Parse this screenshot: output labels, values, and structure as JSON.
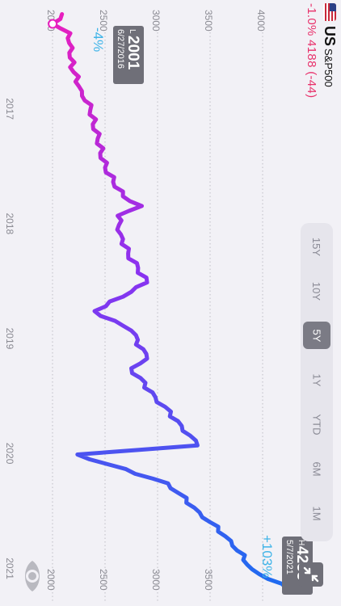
{
  "header": {
    "ticker": "US",
    "index_name": "S&P500",
    "change_text": "-1.0% 4188 (-44)",
    "flag_icon": "us-flag-icon"
  },
  "range_buttons": [
    {
      "label": "15Y",
      "active": false
    },
    {
      "label": "10Y",
      "active": false
    },
    {
      "label": "5Y",
      "active": true
    },
    {
      "label": "1Y",
      "active": false
    },
    {
      "label": "YTD",
      "active": false
    },
    {
      "label": "6M",
      "active": false
    },
    {
      "label": "1M",
      "active": false
    }
  ],
  "colors": {
    "background": "#f2f1f6",
    "negative": "#e8306a",
    "accent_blue": "#3fb4e8",
    "tag_bg": "#6f6f78",
    "line_start": "#e81fbe",
    "line_mid": "#8a32f0",
    "line_end": "#1e6cf0"
  },
  "chart_data": {
    "type": "line",
    "title": "",
    "orientation": "rotated-90",
    "x_axis_labels": [
      "2017",
      "2018",
      "2019",
      "2020",
      "2021"
    ],
    "y_ticks_top": [
      "2000",
      "2500",
      "3000",
      "3500",
      "4000"
    ],
    "y_ticks_bottom": [
      "2000",
      "2500",
      "3000",
      "3500"
    ],
    "ylim": [
      1900,
      4250
    ],
    "grid": true,
    "low": {
      "prefix": "L",
      "value": "2001",
      "date": "6/27/2016",
      "pct": "-4%"
    },
    "high": {
      "prefix": "H",
      "value": "4233",
      "date": "5/7/2021",
      "pct": "+103%"
    },
    "series": [
      {
        "x": [
          "2016-05",
          "2016-06",
          "2016-07",
          "2016-09",
          "2016-11",
          "2017-01",
          "2017-03",
          "2017-06",
          "2017-09",
          "2017-12",
          "2018-01",
          "2018-02",
          "2018-04",
          "2018-06",
          "2018-09",
          "2018-10",
          "2018-12",
          "2019-02",
          "2019-05",
          "2019-06",
          "2019-09",
          "2019-12",
          "2020-02",
          "2020-03",
          "2020-06",
          "2020-09",
          "2020-12",
          "2021-03",
          "2021-05"
        ],
        "values": [
          2090,
          2001,
          2170,
          2160,
          2200,
          2280,
          2360,
          2430,
          2500,
          2670,
          2850,
          2620,
          2650,
          2720,
          2900,
          2750,
          2400,
          2750,
          2900,
          2750,
          2980,
          3230,
          3380,
          2237,
          3100,
          3400,
          3700,
          3900,
          4233
        ]
      }
    ]
  }
}
